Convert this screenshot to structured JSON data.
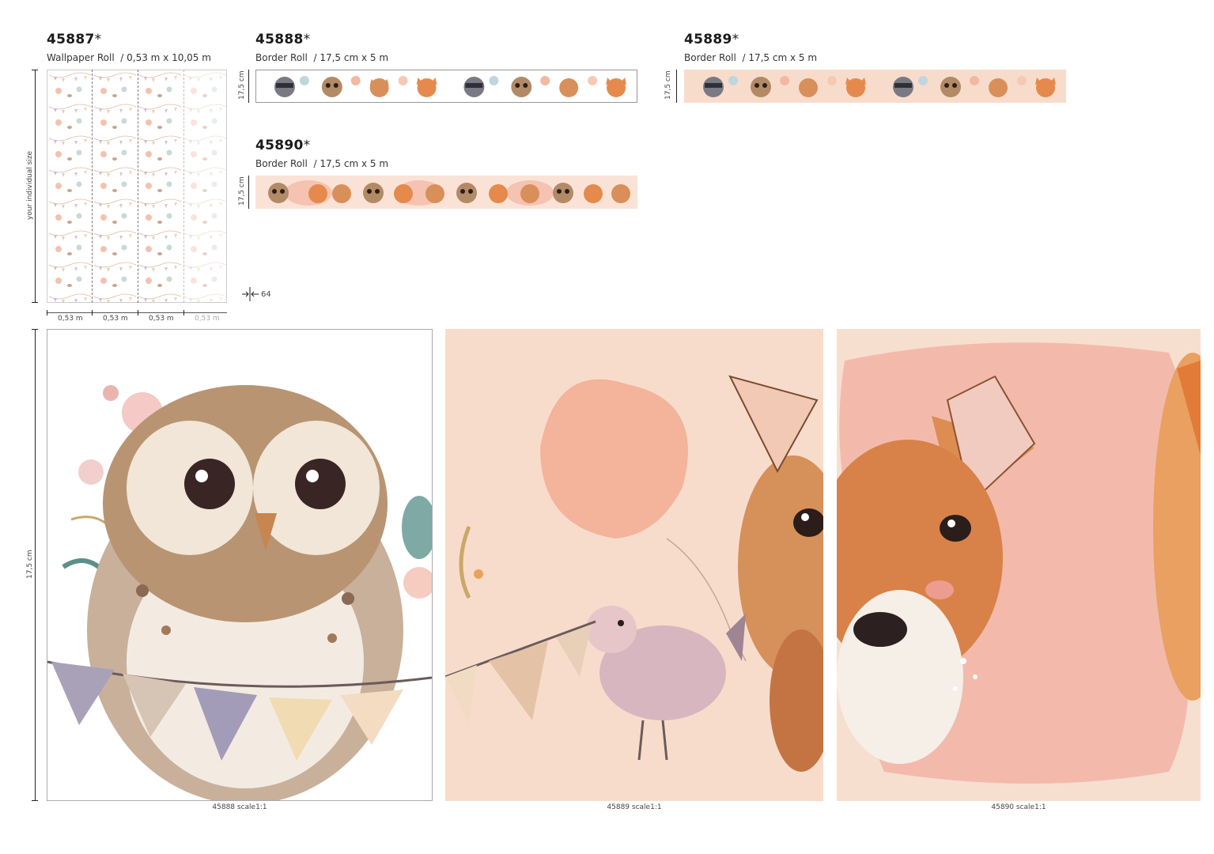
{
  "products": [
    {
      "code": "45887",
      "star": "*",
      "desc": "Wallpaper Roll  / 0,53 m x 10,05 m"
    },
    {
      "code": "45888",
      "star": "*",
      "desc": "Border Roll  / 17,5 cm x 5 m"
    },
    {
      "code": "45889",
      "star": "*",
      "desc": "Border Roll  / 17,5 cm x 5 m"
    },
    {
      "code": "45890",
      "star": "*",
      "desc": "Border Roll  / 17,5 cm x 5 m"
    }
  ],
  "labels": {
    "height_175": "17,5 cm",
    "individual_size": "your individual size",
    "overlap": "64",
    "widths": [
      "0,53 m",
      "0,53 m",
      "0,53 m",
      "0,53 m"
    ]
  },
  "captions": {
    "c45888": "45888 scale1:1",
    "c45889": "45889 scale1:1",
    "c45890": "45890 scale1:1"
  },
  "colors": {
    "peach": "#f8dccb",
    "blush": "#f2b7a6",
    "fox": "#e48a4a",
    "owl": "#a27a55",
    "raccoon": "#6e6e78",
    "balloon": "#f4b39b"
  }
}
